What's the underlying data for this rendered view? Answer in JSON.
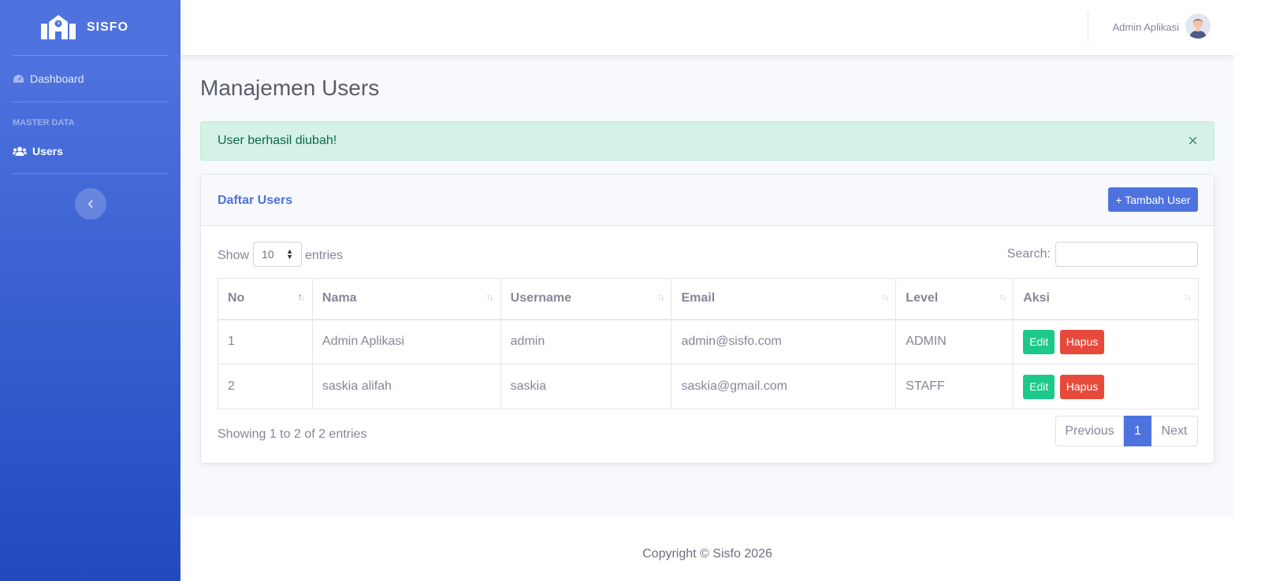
{
  "brand": {
    "name": "SISFO"
  },
  "sidebar": {
    "items": [
      {
        "label": "Dashboard",
        "icon": "dashboard-icon"
      },
      {
        "label": "Users",
        "icon": "users-icon",
        "active": true
      }
    ],
    "heading": "MASTER DATA"
  },
  "topbar": {
    "user_name": "Admin Aplikasi"
  },
  "page": {
    "title": "Manajemen Users"
  },
  "alert": {
    "message": "User berhasil diubah!",
    "close": "×"
  },
  "card": {
    "title": "Daftar Users",
    "add_button": "+ Tambah User"
  },
  "table_controls": {
    "show": "Show",
    "entries_value": "10",
    "entries": "entries",
    "search": "Search:"
  },
  "table": {
    "headers": [
      "No",
      "Nama",
      "Username",
      "Email",
      "Level",
      "Aksi"
    ],
    "rows": [
      {
        "no": "1",
        "nama": "Admin Aplikasi",
        "username": "admin",
        "email": "admin@sisfo.com",
        "level": "ADMIN"
      },
      {
        "no": "2",
        "nama": "saskia alifah",
        "username": "saskia",
        "email": "saskia@gmail.com",
        "level": "STAFF"
      }
    ],
    "edit_label": "Edit",
    "delete_label": "Hapus"
  },
  "pagination": {
    "info": "Showing 1 to 2 of 2 entries",
    "previous": "Previous",
    "current": "1",
    "next": "Next"
  },
  "footer": {
    "copyright": "Copyright © Sisfo 2026"
  },
  "colors": {
    "primary": "#4e73df",
    "success": "#1cc88a",
    "danger": "#e74a3b",
    "alert_bg": "#d4f2e6"
  }
}
